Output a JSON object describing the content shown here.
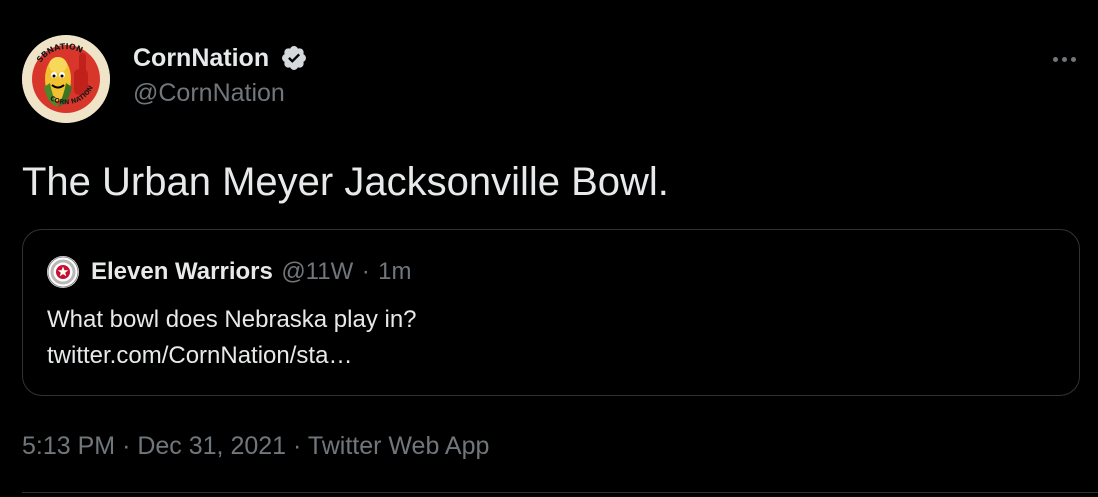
{
  "author": {
    "display_name": "CornNation",
    "handle": "@CornNation",
    "verified": true,
    "avatar_icon": "corn-nation-logo",
    "avatar_text_top": "SBNATION",
    "avatar_text_bottom": "CORN NATION"
  },
  "more_icon": "more-options-icon",
  "tweet": {
    "text": "The Urban Meyer Jacksonville Bowl."
  },
  "quote": {
    "display_name": "Eleven Warriors",
    "handle": "@11W",
    "separator": "·",
    "time": "1m",
    "line1": "What bowl does Nebraska play in?",
    "line2": "twitter.com/CornNation/sta…",
    "avatar_icon": "eleven-warriors-logo"
  },
  "meta": {
    "time": "5:13 PM",
    "date": "Dec 31, 2021",
    "source": "Twitter Web App",
    "separator": "·"
  },
  "colors": {
    "background": "#000000",
    "text": "#e7e9ea",
    "muted": "#71767b",
    "border": "#2f3336"
  }
}
